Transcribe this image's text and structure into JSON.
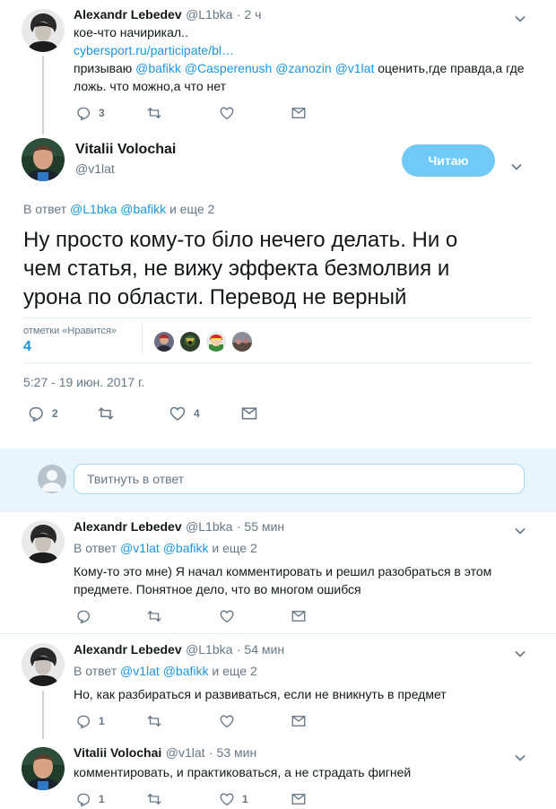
{
  "tweet1": {
    "name": "Alexandr Lebedev",
    "handle": "@L1bka",
    "time": "· 2 ч",
    "line1": "кое-что начирикал..",
    "link": "cybersport.ru/participate/bl…",
    "line3_prefix": "призываю ",
    "mentions": [
      "@bafikk",
      "@Casperenush",
      "@zanozin",
      "@v1lat"
    ],
    "line3_suffix": " оценить,где правда,а где",
    "line4": "ложь. что можно,а что нет",
    "replies": "3",
    "retweets": "",
    "likes": ""
  },
  "main": {
    "name": "Vitalii Volochai",
    "handle": "@v1lat",
    "follow_label": "Читаю",
    "reply_to_prefix": "В ответ ",
    "reply_to_users": [
      "@L1bka",
      "@bafikk"
    ],
    "reply_to_suffix": " и еще 2",
    "text_line1": "Ну просто кому-то біло нечего делать. Ни о",
    "text_line2": "чем статья, не вижу эффекта безмолвия и",
    "text_line3": "урона по области. Перевод не верный",
    "likes_label": "отметки «Нравится»",
    "likes_count": "4",
    "timestamp": "5:27 - 19 июн. 2017 г.",
    "replies": "2",
    "retweets": "",
    "likes": "4"
  },
  "reply_box": {
    "placeholder": "Твитнуть в ответ"
  },
  "tweet2": {
    "name": "Alexandr Lebedev",
    "handle": "@L1bka",
    "time": "· 55 мин",
    "reply_to_prefix": "В ответ ",
    "reply_to_users": [
      "@v1lat",
      "@bafikk"
    ],
    "reply_to_suffix": " и еще 2",
    "line1": "Кому-то это мне) Я начал комментировать и решил разобраться в этом",
    "line2": "предмете. Понятное дело, что во многом ошибся",
    "replies": "",
    "retweets": "",
    "likes": ""
  },
  "tweet3": {
    "name": "Alexandr Lebedev",
    "handle": "@L1bka",
    "time": "· 54 мин",
    "reply_to_prefix": "В ответ ",
    "reply_to_users": [
      "@v1lat",
      "@bafikk"
    ],
    "reply_to_suffix": " и еще 2",
    "line1": "Но, как разбираться и развиваться, если не вникнуть в предмет",
    "replies": "1",
    "retweets": "",
    "likes": ""
  },
  "tweet4": {
    "name": "Vitalii Volochai",
    "handle": "@v1lat",
    "time": "· 53 мин",
    "line1": "комментировать, и практиковаться, а не страдать фигней",
    "replies": "1",
    "retweets": "",
    "likes": "1"
  },
  "colors": {
    "link": "#1b95e0",
    "follow_button": "#71c9f8",
    "reply_bar": "#e8f5fd",
    "muted": "#657786",
    "thread_line": "#ccd6dd"
  }
}
